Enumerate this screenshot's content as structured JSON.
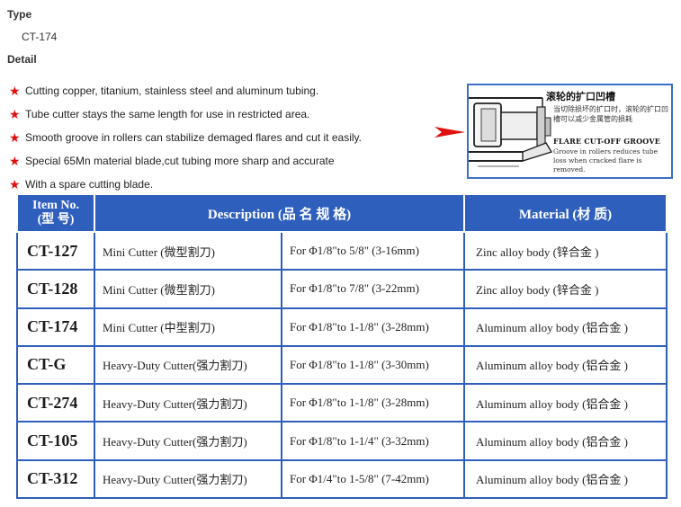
{
  "type_section": {
    "label": "Type",
    "value": "CT-174"
  },
  "detail_section": {
    "label": "Detail",
    "features": [
      "Cutting copper, titanium, stainless steel and aluminum tubing.",
      "Tube cutter stays the same length for use in restricted area.",
      "Smooth groove in rollers can stabilize demaged flares and cut it easily.",
      "Special 65Mn material blade,cut tubing more sharp and accurate",
      "With a spare cutting blade."
    ]
  },
  "diagram": {
    "title": "滚轮的扩口凹槽",
    "subtitle": "当切除损坏的扩口时，滚轮的扩口凹槽可以减少金属管的损耗",
    "flare_label": "FLARE CUT-OFF GROOVE",
    "description": "Groove in rollers reduces tube loss when cracked flare is removed."
  },
  "table": {
    "headers": {
      "item_no_line1": "Item No.",
      "item_no_line2": "(型 号)",
      "description": "Description (品 名 规 格)",
      "material": "Material (材 质)"
    },
    "rows": [
      {
        "item": "CT-127",
        "name": "Mini Cutter (微型割刀)",
        "range": "For Φ1/8\"to 5/8\" (3-16mm)",
        "material": "Zinc alloy body (锌合金 )"
      },
      {
        "item": "CT-128",
        "name": "Mini Cutter (微型割刀)",
        "range": "For Φ1/8\"to 7/8\" (3-22mm)",
        "material": "Zinc alloy body (锌合金 )"
      },
      {
        "item": "CT-174",
        "name": "Mini Cutter (中型割刀)",
        "range": "For Φ1/8\"to 1-1/8\" (3-28mm)",
        "material": "Aluminum alloy body (铝合金 )"
      },
      {
        "item": "CT-G",
        "name": "Heavy-Duty Cutter(强力割刀)",
        "range": "For Φ1/8\"to 1-1/8\" (3-30mm)",
        "material": "Aluminum alloy body (铝合金 )"
      },
      {
        "item": "CT-274",
        "name": "Heavy-Duty Cutter(强力割刀)",
        "range": "For Φ1/8\"to 1-1/8\" (3-28mm)",
        "material": "Aluminum alloy body (铝合金 )"
      },
      {
        "item": "CT-105",
        "name": "Heavy-Duty Cutter(强力割刀)",
        "range": "For Φ1/8\"to 1-1/4\" (3-32mm)",
        "material": "Aluminum alloy body (铝合金 )"
      },
      {
        "item": "CT-312",
        "name": "Heavy-Duty Cutter(强力割刀)",
        "range": "For Φ1/4\"to 1-5/8\" (7-42mm)",
        "material": "Aluminum alloy body (铝合金 )"
      }
    ]
  },
  "colors": {
    "star": "#e01010",
    "table_header": "#2e5fbd",
    "diagram_border": "#3a6fc4"
  }
}
